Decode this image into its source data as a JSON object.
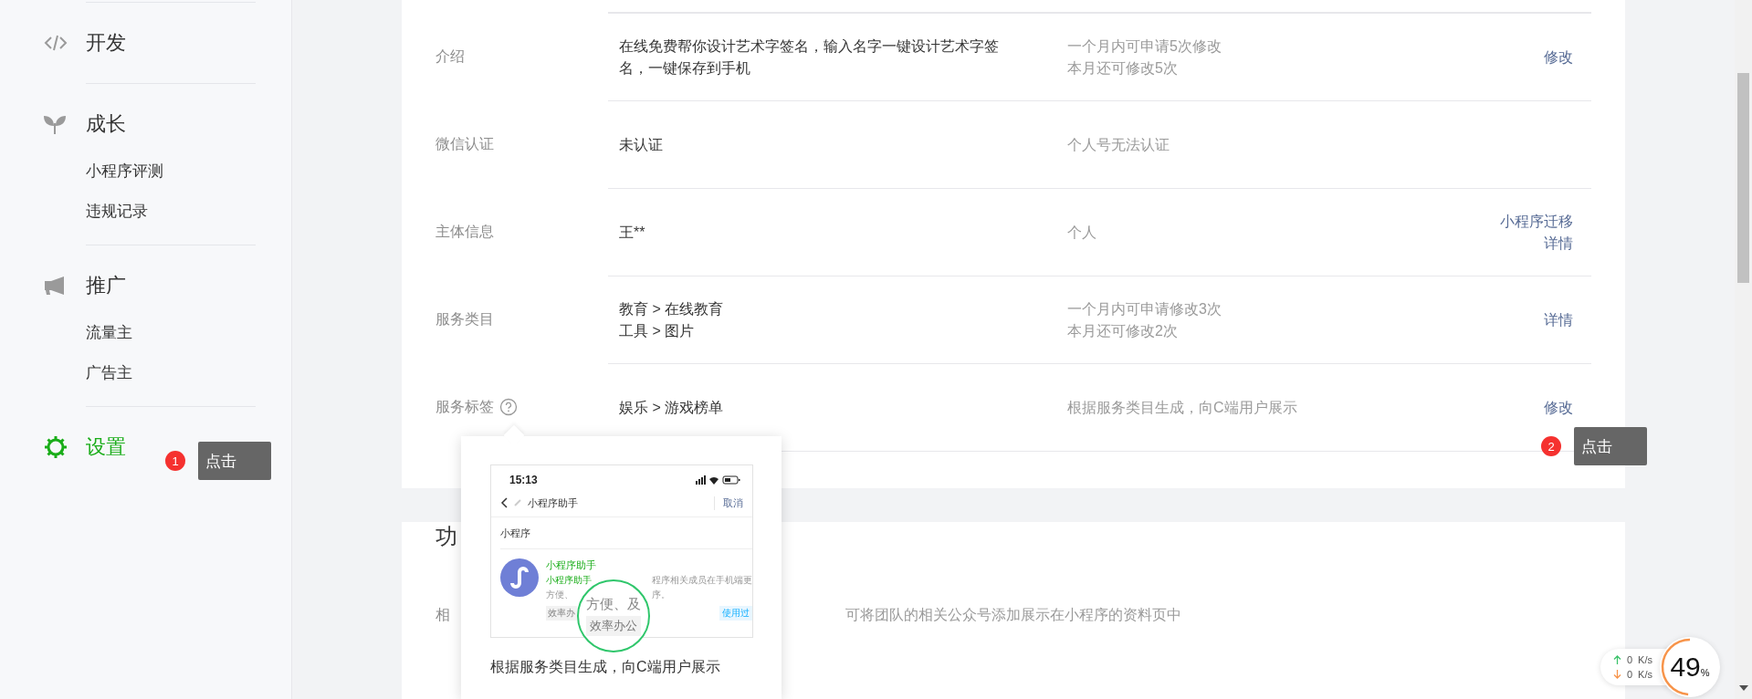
{
  "sidebar": {
    "sections": [
      {
        "title": "开发",
        "selected": false
      },
      {
        "title": "成长",
        "selected": false,
        "items": [
          "小程序评测",
          "违规记录"
        ]
      },
      {
        "title": "推广",
        "selected": false,
        "items": [
          "流量主",
          "广告主"
        ]
      },
      {
        "title": "设置",
        "selected": true
      }
    ],
    "callout": {
      "number": "1",
      "text": "点击"
    }
  },
  "info_card": {
    "rows": [
      {
        "label": "介绍",
        "value": [
          "在线免费帮你设计艺术字签名，输入名字一键设计艺术字签",
          "名，一键保存到手机"
        ],
        "desc": [
          "一个月内可申请5次修改",
          "本月还可修改5次"
        ],
        "actions": [
          "修改"
        ]
      },
      {
        "label": "微信认证",
        "value": [
          "未认证"
        ],
        "desc": [
          "个人号无法认证"
        ]
      },
      {
        "label": "主体信息",
        "value": [
          "王**"
        ],
        "desc": [
          "个人"
        ],
        "actions": [
          "小程序迁移",
          "详情"
        ]
      },
      {
        "label": "服务类目",
        "value": [
          "教育 > 在线教育",
          "工具 > 图片"
        ],
        "desc": [
          "一个月内可申请修改3次",
          "本月还可修改2次"
        ],
        "actions": [
          "详情"
        ]
      },
      {
        "label": "服务标签",
        "help": true,
        "value": [
          "娱乐 > 游戏榜单"
        ],
        "desc": [
          "根据服务类目生成，向C端用户展示"
        ],
        "actions": [
          "修改"
        ]
      }
    ],
    "callout": {
      "number": "2",
      "text": "点击"
    }
  },
  "feature_card": {
    "title": "功",
    "rows": [
      {
        "label": "相",
        "desc": "可将团队的相关公众号添加展示在小程序的资料页中"
      }
    ]
  },
  "help_popover": {
    "phone": {
      "time": "15:13",
      "search": "小程序助手",
      "cancel": "取消",
      "section": "小程序",
      "result_title": "小程序助手",
      "desc_highlight": "小程序助手",
      "desc_line1": "程序相关成员在手机端更",
      "desc_line2_start": "方便、",
      "desc_line2_end": "序。",
      "tag": "效率办",
      "badge": "使用过",
      "zoom_text": "方便、及",
      "zoom_tag": "效率办公"
    },
    "caption": "根据服务类目生成，向C端用户展示"
  },
  "net_widget": {
    "up": {
      "value": "0",
      "unit": "K/s"
    },
    "down": {
      "value": "0",
      "unit": "K/s"
    },
    "percent": "49",
    "percent_sign": "%",
    "level": 0.49
  }
}
